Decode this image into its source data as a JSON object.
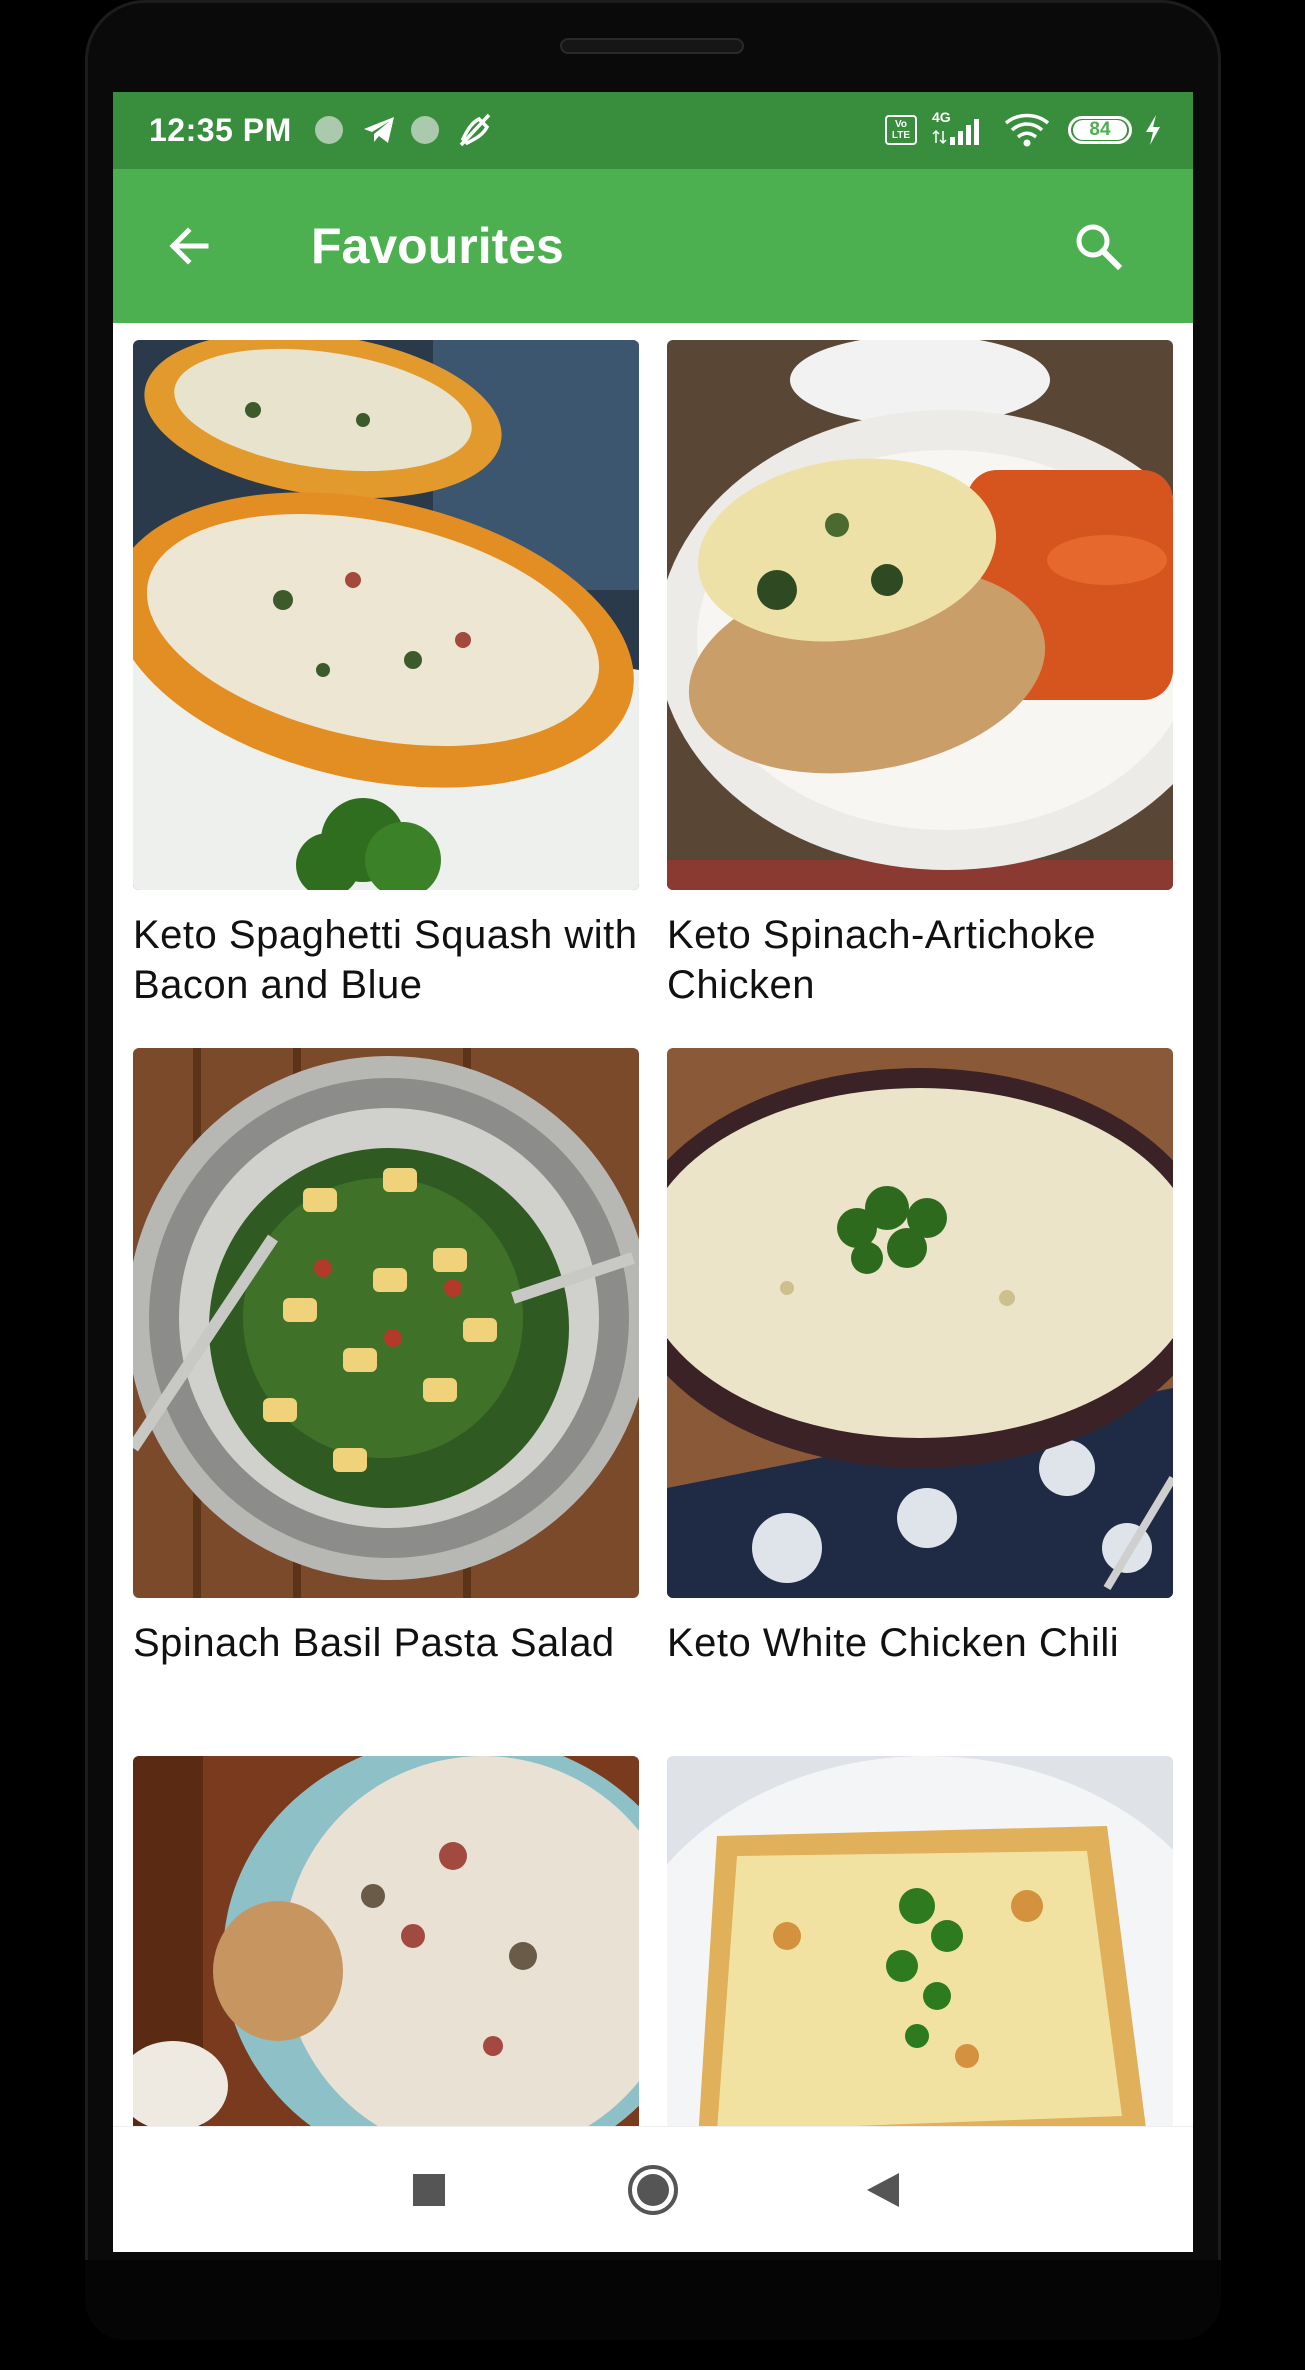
{
  "status_bar": {
    "time": "12:35 PM",
    "network": "4G",
    "volte": "Vo LTE",
    "battery": "84",
    "icons": [
      "notification-dot-icon",
      "telegram-icon",
      "notification-dot-icon",
      "mute-icon",
      "volte-icon",
      "signal-icon",
      "wifi-icon",
      "battery-icon",
      "charging-icon"
    ]
  },
  "app_bar": {
    "title": "Favourites",
    "back_icon": "arrow-back-icon",
    "search_icon": "search-icon"
  },
  "recipes": [
    {
      "title": "Keto Spaghetti Squash with Bacon and Blue"
    },
    {
      "title": "Keto Spinach-Artichoke Chicken"
    },
    {
      "title": "Spinach Basil Pasta Salad"
    },
    {
      "title": "Keto White Chicken Chili"
    },
    {
      "title": ""
    },
    {
      "title": ""
    }
  ],
  "nav_bar": {
    "icons": [
      "recents-square-icon",
      "home-circle-icon",
      "back-triangle-icon"
    ]
  },
  "colors": {
    "status_bar": "#388e3c",
    "app_bar": "#4caf50",
    "battery_text": "#4caf50"
  }
}
